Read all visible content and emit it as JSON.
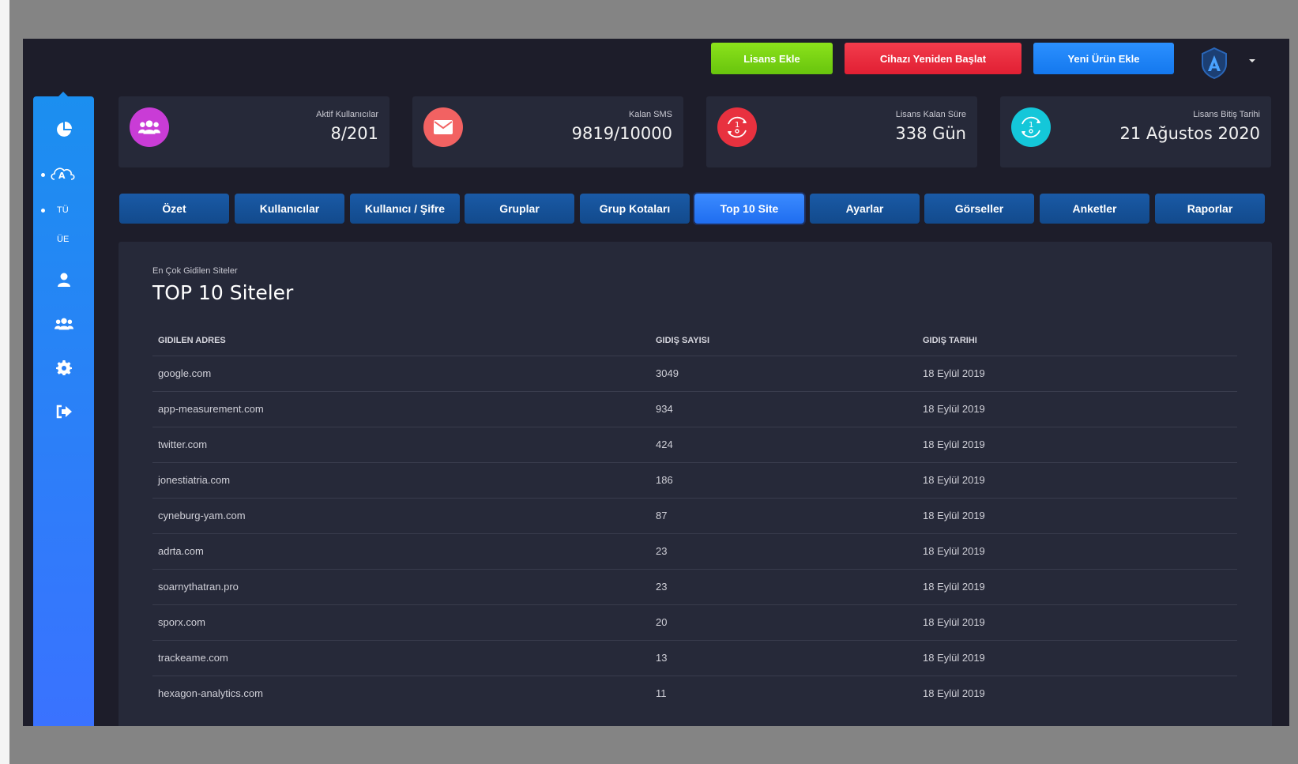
{
  "topbar": {
    "license_add": "Lisans Ekle",
    "restart_device": "Cihazı Yeniden Başlat",
    "new_product": "Yeni Ürün Ekle"
  },
  "sidebar": {
    "items": [
      {
        "icon": "pie-chart-icon"
      },
      {
        "icon": "cloud-a-icon"
      },
      {
        "label": "TÜ"
      },
      {
        "label": "ÜE"
      },
      {
        "icon": "user-icon"
      },
      {
        "icon": "users-icon"
      },
      {
        "icon": "gear-icon"
      },
      {
        "icon": "logout-icon"
      }
    ]
  },
  "stats": [
    {
      "label": "Aktif Kullanıcılar",
      "value": "8/201",
      "icon": "users-icon",
      "color": "#c93cd6"
    },
    {
      "label": "Kalan SMS",
      "value": "9819/10000",
      "icon": "envelope-icon",
      "color": "#f26262"
    },
    {
      "label": "Lisans Kalan Süre",
      "value": "338 Gün",
      "icon": "timer-icon",
      "color": "#e8313f"
    },
    {
      "label": "Lisans Bitiş Tarihi",
      "value": "21 Ağustos 2020",
      "icon": "timer-icon",
      "color": "#14c7d9"
    }
  ],
  "tabs": [
    {
      "label": "Özet"
    },
    {
      "label": "Kullanıcılar"
    },
    {
      "label": "Kullanıcı / Şifre"
    },
    {
      "label": "Gruplar"
    },
    {
      "label": "Grup Kotaları"
    },
    {
      "label": "Top 10 Site",
      "active": true
    },
    {
      "label": "Ayarlar"
    },
    {
      "label": "Görseller"
    },
    {
      "label": "Anketler"
    },
    {
      "label": "Raporlar"
    }
  ],
  "panel": {
    "subtitle": "En Çok Gidilen Siteler",
    "title": "TOP 10 Siteler",
    "columns": [
      "GIDILEN ADRES",
      "GIDIŞ SAYISI",
      "GIDIŞ TARIHI"
    ],
    "rows": [
      [
        "google.com",
        "3049",
        "18 Eylül 2019"
      ],
      [
        "app-measurement.com",
        "934",
        "18 Eylül 2019"
      ],
      [
        "twitter.com",
        "424",
        "18 Eylül 2019"
      ],
      [
        "jonestiatria.com",
        "186",
        "18 Eylül 2019"
      ],
      [
        "cyneburg-yam.com",
        "87",
        "18 Eylül 2019"
      ],
      [
        "adrta.com",
        "23",
        "18 Eylül 2019"
      ],
      [
        "soarnythatran.pro",
        "23",
        "18 Eylül 2019"
      ],
      [
        "sporx.com",
        "20",
        "18 Eylül 2019"
      ],
      [
        "trackeame.com",
        "13",
        "18 Eylül 2019"
      ],
      [
        "hexagon-analytics.com",
        "11",
        "18 Eylül 2019"
      ]
    ]
  }
}
